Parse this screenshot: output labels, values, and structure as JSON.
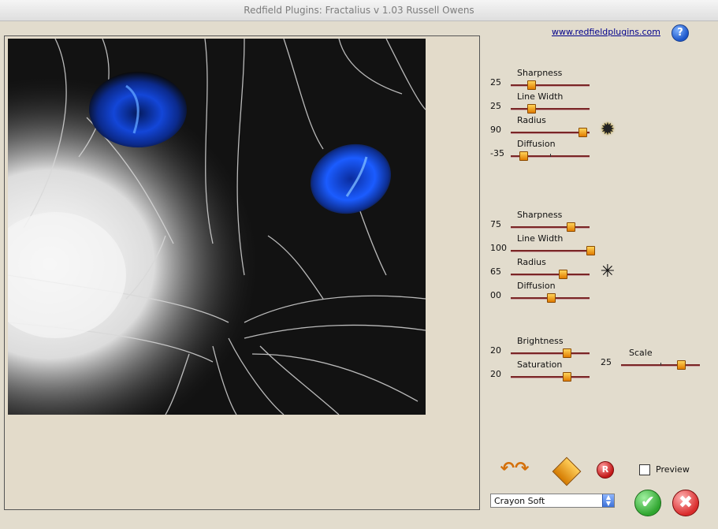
{
  "window": {
    "title": "Redfield Plugins: Fractalius v 1.03    Russell Owens"
  },
  "header": {
    "link_text": "www.redfieldplugins.com",
    "help_glyph": "?"
  },
  "group1": {
    "sharpness": {
      "label": "Sharpness",
      "value": "25",
      "fraction": 0.25
    },
    "line_width": {
      "label": "Line Width",
      "value": "25",
      "fraction": 0.25
    },
    "radius": {
      "label": "Radius",
      "value": "90",
      "fraction": 0.9
    },
    "diffusion": {
      "label": "Diffusion",
      "value": "-35",
      "fraction": 0.15
    },
    "icon": "starburst-icon"
  },
  "group2": {
    "sharpness": {
      "label": "Sharpness",
      "value": "75",
      "fraction": 0.75
    },
    "line_width": {
      "label": "Line Width",
      "value": "100",
      "fraction": 1.0
    },
    "radius": {
      "label": "Radius",
      "value": "65",
      "fraction": 0.65
    },
    "diffusion": {
      "label": "Diffusion",
      "value": "00",
      "fraction": 0.5
    },
    "icon": "asterisk-icon"
  },
  "group3": {
    "brightness": {
      "label": "Brightness",
      "value": "20",
      "fraction": 0.7
    },
    "saturation": {
      "label": "Saturation",
      "value": "20",
      "fraction": 0.7
    },
    "scale": {
      "label": "Scale",
      "value": "25",
      "fraction": 0.75
    }
  },
  "bottom": {
    "preview_label": "Preview",
    "preview_checked": false,
    "preset_value": "Crayon Soft",
    "ok_glyph": "✔",
    "cancel_glyph": "✖",
    "undo_redo_glyph": "↶↷",
    "random_glyph": "✦",
    "reset_glyph": "R"
  },
  "colors": {
    "accent_orange": "#e07c00",
    "slider_track": "#7a2525",
    "ok_green": "#2fa52f",
    "cancel_red": "#d92c2c"
  }
}
